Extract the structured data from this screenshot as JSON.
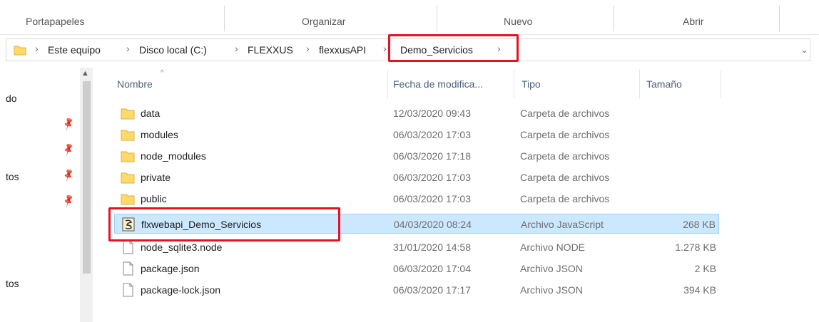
{
  "ribbon": {
    "groups": [
      "Portapapeles",
      "Organizar",
      "Nuevo",
      "Abrir"
    ]
  },
  "address_bar": {
    "crumbs": [
      "Este equipo",
      "Disco local (C:)",
      "FLEXXUS",
      "flexxusAPI",
      "Demo_Servicios"
    ]
  },
  "nav_pane": {
    "items": [
      "do",
      "tos",
      "tos"
    ]
  },
  "columns": [
    "Nombre",
    "Fecha de modifica...",
    "Tipo",
    "Tamaño"
  ],
  "files": [
    {
      "name": "data",
      "date": "12/03/2020 09:43",
      "type": "Carpeta de archivos",
      "size": "",
      "icon": "folder-icon"
    },
    {
      "name": "modules",
      "date": "06/03/2020 17:03",
      "type": "Carpeta de archivos",
      "size": "",
      "icon": "folder-icon"
    },
    {
      "name": "node_modules",
      "date": "06/03/2020 17:18",
      "type": "Carpeta de archivos",
      "size": "",
      "icon": "folder-icon"
    },
    {
      "name": "private",
      "date": "06/03/2020 17:03",
      "type": "Carpeta de archivos",
      "size": "",
      "icon": "folder-icon"
    },
    {
      "name": "public",
      "date": "06/03/2020 17:03",
      "type": "Carpeta de archivos",
      "size": "",
      "icon": "folder-icon"
    },
    {
      "name": "flxwebapi_Demo_Servicios",
      "date": "04/03/2020 08:24",
      "type": "Archivo JavaScript",
      "size": "268 KB",
      "icon": "javascript-file-icon"
    },
    {
      "name": "node_sqlite3.node",
      "date": "31/01/2020 14:58",
      "type": "Archivo NODE",
      "size": "1.278 KB",
      "icon": "file-icon"
    },
    {
      "name": "package.json",
      "date": "06/03/2020 17:04",
      "type": "Archivo JSON",
      "size": "2 KB",
      "icon": "file-icon"
    },
    {
      "name": "package-lock.json",
      "date": "06/03/2020 17:17",
      "type": "Archivo JSON",
      "size": "394 KB",
      "icon": "file-icon"
    }
  ],
  "colors": {
    "highlight_box": "#e81123",
    "selection_bg": "#cce8ff",
    "folder": "#ffd96a"
  }
}
